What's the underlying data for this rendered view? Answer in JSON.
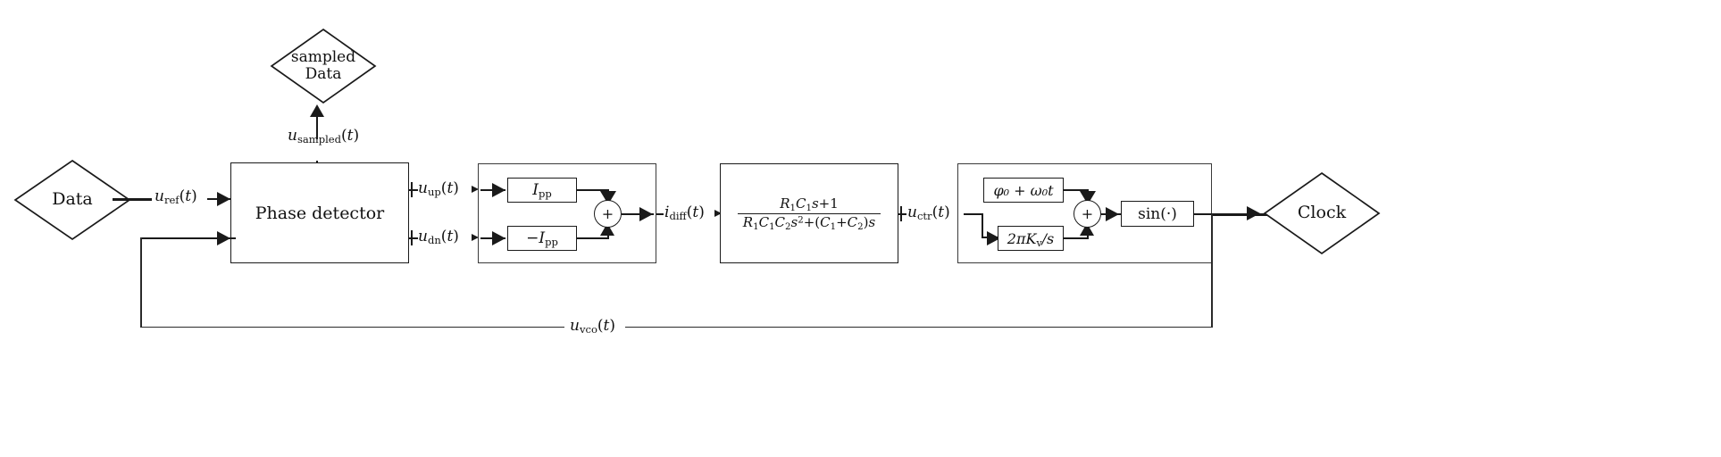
{
  "diagram": {
    "title": "PLL / clock-and-data-recovery block diagram",
    "background": "#ffffff",
    "line_color": "#1a1a1a"
  },
  "terminals": {
    "data_in": "Data",
    "sampled_data_line1": "sampled",
    "sampled_data_line2": "Data",
    "clock_out": "Clock"
  },
  "blocks": {
    "phase_detector": "Phase detector",
    "charge_pump_up": "I",
    "charge_pump_up_sub": "pp",
    "charge_pump_dn_sign": "−",
    "charge_pump_dn": "I",
    "charge_pump_dn_sub": "pp",
    "summer_symbol": "+",
    "loop_filter_num": "R₁C₁s+1",
    "loop_filter_den": "R₁C₁C₂s²+(C₁+C₂)s",
    "vco_phase_offset": "φ₀ + ω₀t",
    "vco_gain": "2πKᵥ/s",
    "vco_summer_symbol": "+",
    "vco_sine": "sin(·)"
  },
  "signals": {
    "u_ref": "uᵣₑғ(t)",
    "u_sampled": "uₛₐₘₚₗₑₔ(t)",
    "u_up": "uᵤₚ(t)",
    "u_dn": "uₔₙ(t)",
    "i_diff": "iₔᵢₓₓ(t)",
    "u_ctr": "u꜀ₜᵣ(t)",
    "u_vco": "uᵥ꜀ₒ(t)"
  },
  "signal_parts": {
    "u_ref": {
      "base": "u",
      "sub": "ref",
      "arg": "(t)"
    },
    "u_sampled": {
      "base": "u",
      "sub": "sampled",
      "arg": "(t)"
    },
    "u_up": {
      "base": "u",
      "sub": "up",
      "arg": "(t)"
    },
    "u_dn": {
      "base": "u",
      "sub": "dn",
      "arg": "(t)"
    },
    "i_diff": {
      "base": "i",
      "sub": "diff",
      "arg": "(t)"
    },
    "u_ctr": {
      "base": "u",
      "sub": "ctr",
      "arg": "(t)"
    },
    "u_vco": {
      "base": "u",
      "sub": "vco",
      "arg": "(t)"
    }
  },
  "loop_filter_parts": {
    "num": {
      "R": "R",
      "R_sub": "1",
      "C": "C",
      "C_sub": "1",
      "s": "s",
      "plus_one": "+1"
    },
    "den": {
      "text": "R₁C₁C₂s²+(C₁+C₂)s"
    }
  }
}
